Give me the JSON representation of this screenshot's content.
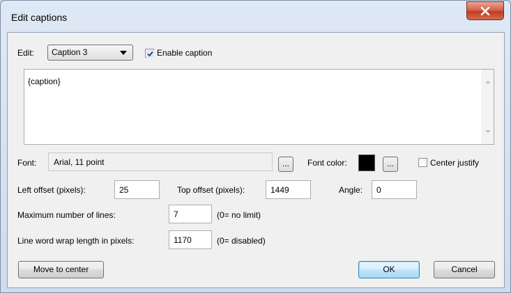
{
  "window": {
    "title": "Edit captions",
    "close_glyph": "✕"
  },
  "edit": {
    "label": "Edit:",
    "selected": "Caption 3",
    "enable_caption_label": "Enable caption",
    "enable_caption_checked": true
  },
  "caption_text": "{caption}",
  "font": {
    "label": "Font:",
    "value": "Arial, 11 point",
    "browse_label": "...",
    "color_label": "Font color:",
    "color_value": "#000000",
    "color_browse_label": "...",
    "center_justify_label": "Center justify",
    "center_justify_checked": false
  },
  "offsets": {
    "left_label": "Left offset (pixels):",
    "left_value": "25",
    "top_label": "Top offset (pixels):",
    "top_value": "1449",
    "angle_label": "Angle:",
    "angle_value": "0"
  },
  "lines": {
    "max_label": "Maximum number of lines:",
    "max_value": "7",
    "max_hint": "(0= no limit)",
    "wrap_label": "Line word wrap length in pixels:",
    "wrap_value": "1170",
    "wrap_hint": "(0= disabled)"
  },
  "buttons": {
    "move_to_center": "Move to center",
    "ok": "OK",
    "cancel": "Cancel"
  }
}
